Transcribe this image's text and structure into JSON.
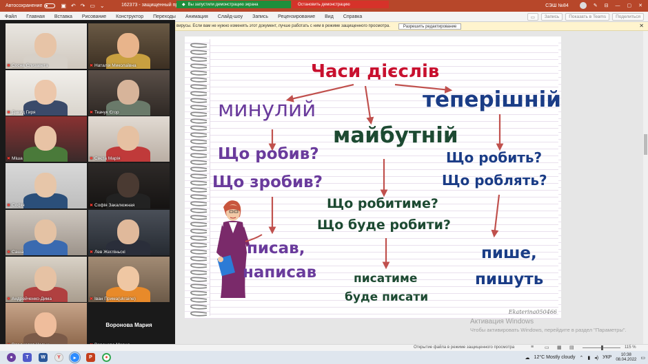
{
  "titlebar": {
    "autosave_label": "Автосохранение",
    "doc_title": "162373 - защищенный про",
    "share_banner": "Вы запустили демонстрацию экрана",
    "stop_share": "Остановить демонстрацию",
    "user_name": "СЭШ №84"
  },
  "ribbon": {
    "tabs": [
      "Файл",
      "Главная",
      "Вставка",
      "Рисование",
      "Конструктор",
      "Переходы",
      "Анимация",
      "Слайд-шоу",
      "Запись",
      "Рецензирование",
      "Вид",
      "Справка"
    ],
    "record_label": "Запись",
    "teams_label": "Показать в Teams",
    "share_label": "Поделиться"
  },
  "protected_view": {
    "message": "вирусы. Если вам не нужно изменять этот документ, лучше работать с ним в режиме защищенного просмотра.",
    "button": "Разрешить редактирование"
  },
  "participants": [
    {
      "name": "Сосна Єлизавета"
    },
    {
      "name": "Наталія Миколаївна"
    },
    {
      "name": "Давид Гиря"
    },
    {
      "name": "Ткачук Єгор"
    },
    {
      "name": "Міша"
    },
    {
      "name": "Свєта Марія"
    },
    {
      "name": "Софія"
    },
    {
      "name": "Софія Закалюжная"
    },
    {
      "name": "Саша"
    },
    {
      "name": "Лев Жегліньскі"
    },
    {
      "name": "Андрейченко-Дима"
    },
    {
      "name": "Іван Прима(ukraine)"
    },
    {
      "name": "Владислав Чалык"
    },
    {
      "name": "Воронова Мария",
      "center_label": "Воронова Мария"
    }
  ],
  "slide": {
    "title": "Часи дієслів",
    "past": "минулий",
    "present": "теперішній",
    "future": "майбутній",
    "past_q1": "Що робив?",
    "past_q2": "Що зробив?",
    "present_q1": "Що робить?",
    "present_q2": "Що роблять?",
    "future_q1": "Що робитиме?",
    "future_q2": "Що буде робити?",
    "past_a1": "писав,",
    "past_a2": "написав",
    "future_a1": "писатиме",
    "future_a2": "буде писати",
    "present_a1": "пише,",
    "present_a2": "пишуть",
    "signature": "Ekaterina050466"
  },
  "watermark": {
    "title": "Активация Windows",
    "subtitle": "Чтобы активировать Windows, перейдите в раздел \"Параметры\"."
  },
  "statusbar": {
    "message": "Открытие файла в режиме защищенного просмотра",
    "zoom": "115 %"
  },
  "taskbar": {
    "weather": "12°C  Mostly cloudy",
    "lang": "УКР",
    "time": "10:38",
    "date": "08.04.2022"
  },
  "colors": {
    "ppt_accent": "#b7472a",
    "title_red": "#c8102e",
    "purple": "#6a3b9c",
    "blue": "#1a3c86",
    "green": "#1d4a32"
  }
}
